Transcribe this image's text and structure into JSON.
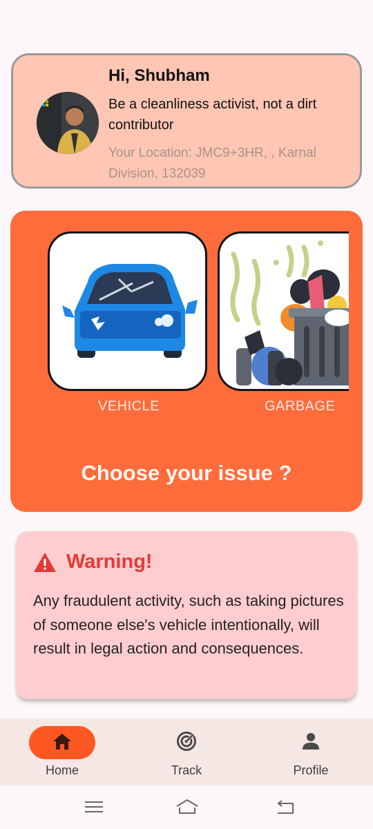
{
  "profile": {
    "greeting": "Hi, Shubham",
    "tagline": "Be a cleanliness activist, not a dirt contributor",
    "location": "Your Location: JMC9+3HR, , Karnal Division, 132039",
    "avatar_badge": "Microsoft"
  },
  "issues": {
    "vehicle_label": "VEHICLE",
    "garbage_label": "GARBAGE",
    "title": "Choose your issue ?"
  },
  "warning": {
    "title": "Warning!",
    "text": "Any fraudulent activity, such as taking pictures of someone else's vehicle intentionally, will result in legal action and consequences."
  },
  "nav": {
    "home": "Home",
    "track": "Track",
    "profile": "Profile",
    "active": "home"
  },
  "colors": {
    "accent": "#ff6c3c",
    "nav_active": "#ff5722",
    "profile_bg": "#ffc6b4",
    "warning_bg": "#ffcdd0",
    "warning_text": "#e53935"
  },
  "icons": {
    "home": "home-icon",
    "track": "radar-icon",
    "profile": "person-icon",
    "warning": "warning-triangle-icon",
    "system": [
      "menu-icon",
      "home-outline-icon",
      "back-icon"
    ]
  }
}
